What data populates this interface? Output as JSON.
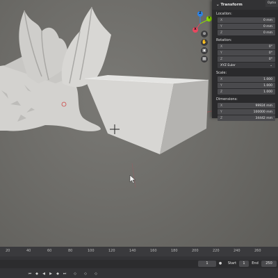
{
  "options_tab": "Optio",
  "gizmo": {
    "z": "Z",
    "y": "Y",
    "x": "X"
  },
  "sidebar": {
    "panel_title": "Transform",
    "location_label": "Location:",
    "location": [
      {
        "axis": "X",
        "value": "0 mm"
      },
      {
        "axis": "Y",
        "value": "0 mm"
      },
      {
        "axis": "Z",
        "value": "0 mm"
      }
    ],
    "rotation_label": "Rotation:",
    "rotation": [
      {
        "axis": "X",
        "value": "0°"
      },
      {
        "axis": "Y",
        "value": "0°"
      },
      {
        "axis": "Z",
        "value": "0°"
      }
    ],
    "rotation_mode": "XYZ Euler",
    "scale_label": "Scale:",
    "scale": [
      {
        "axis": "X",
        "value": "1.000"
      },
      {
        "axis": "Y",
        "value": "1.000"
      },
      {
        "axis": "Z",
        "value": "1.000"
      }
    ],
    "dimensions_label": "Dimensions:",
    "dimensions": [
      {
        "axis": "X",
        "value": "99924 mm"
      },
      {
        "axis": "Y",
        "value": "100000 mm"
      },
      {
        "axis": "Z",
        "value": "34442 mm"
      }
    ]
  },
  "ruler_ticks": [
    "20",
    "40",
    "60",
    "80",
    "100",
    "120",
    "140",
    "160",
    "180",
    "200",
    "220",
    "240",
    "260"
  ],
  "timeline": {
    "current_frame": "1",
    "start_label": "Start",
    "start_value": "1",
    "end_label": "End",
    "end_value": "250"
  },
  "colors": {
    "x_axis": "#e8475f",
    "y_axis": "#8bdc00",
    "z_axis": "#2f83e3",
    "accent": "#4772b3"
  }
}
